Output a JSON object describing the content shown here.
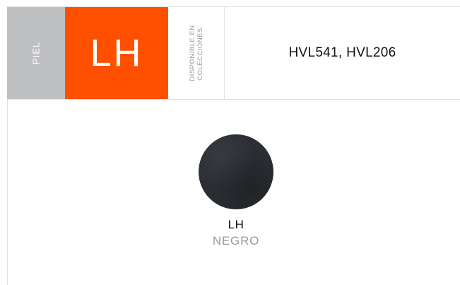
{
  "header": {
    "category": "PIEL",
    "code": "LH",
    "available_line1": "DISPONIBLE EN",
    "available_line2": "COLECCIONES:",
    "collections": "HVL541, HVL206"
  },
  "swatches": [
    {
      "code": "LH",
      "name": "NEGRO",
      "color": "#2b2e33"
    }
  ],
  "colors": {
    "accent": "#ff5000",
    "category_bg": "#bfc0c2",
    "muted_text": "#9a9a9a"
  }
}
